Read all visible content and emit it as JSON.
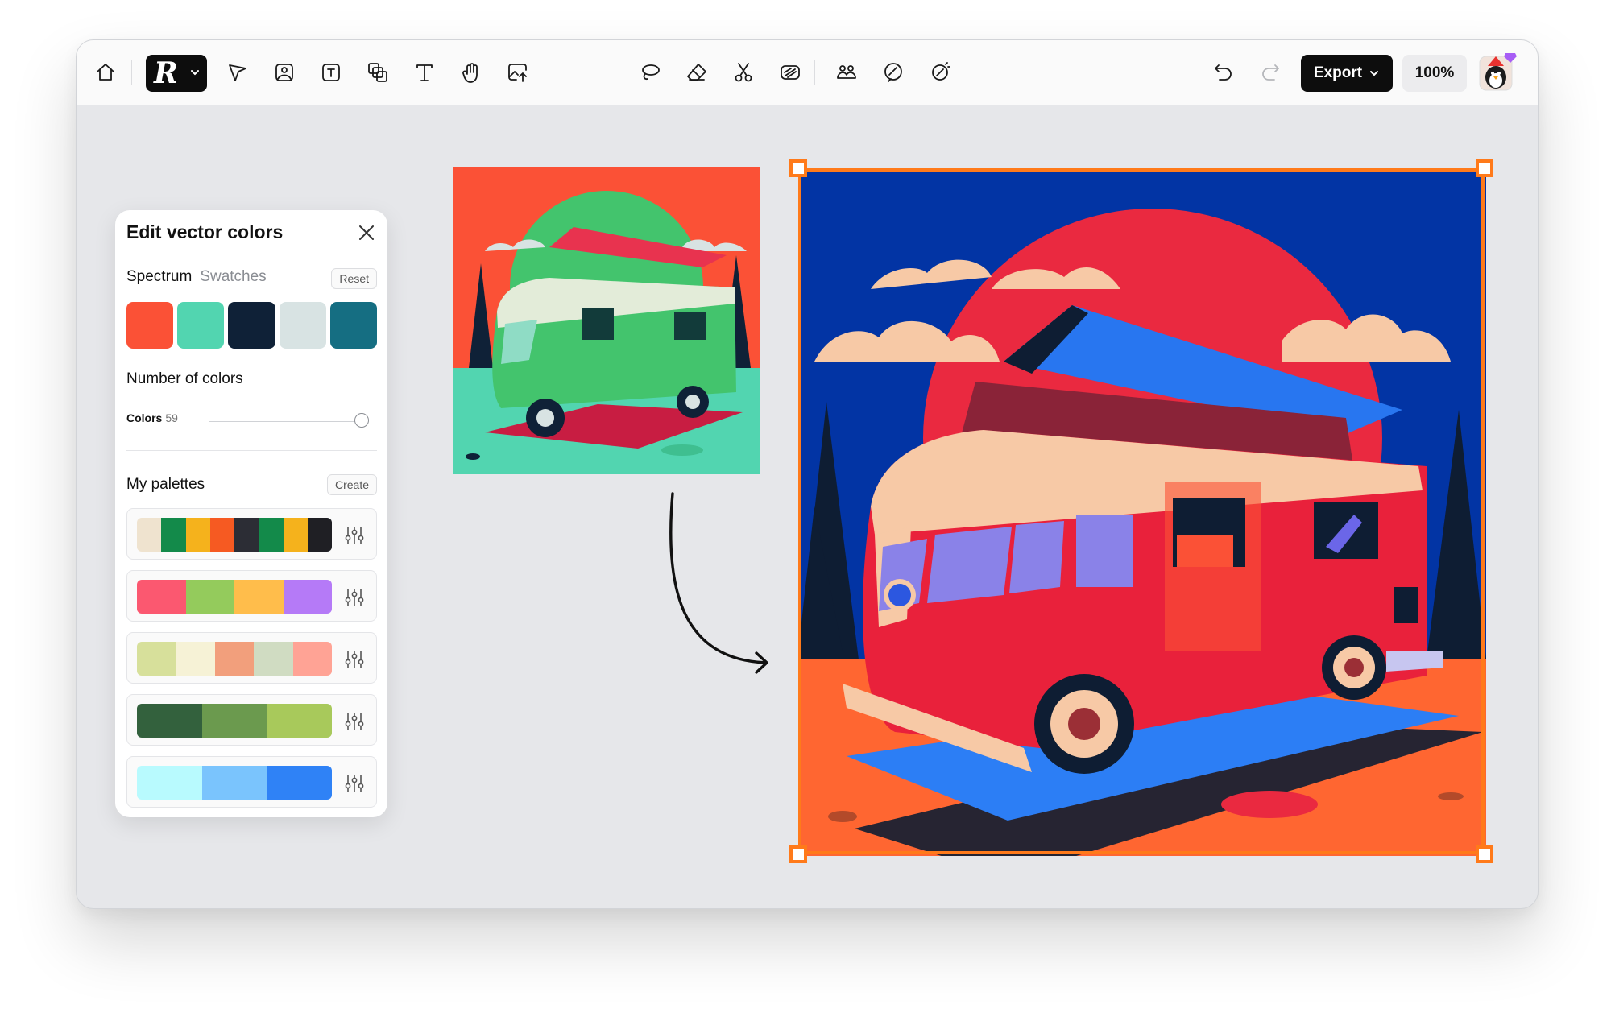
{
  "toolbar": {
    "export_label": "Export",
    "zoom_label": "100%",
    "tools_left": [
      "home-icon",
      "pen-tool-icon",
      "image-icon",
      "image-text-icon",
      "layers-icon",
      "text-icon",
      "hand-icon",
      "upload-image-icon"
    ],
    "tools_center": [
      "lasso-icon",
      "eraser-icon",
      "scissors-icon",
      "vectorize-icon",
      "people-icon",
      "sticker-icon",
      "magic-icon"
    ]
  },
  "panel": {
    "title": "Edit vector colors",
    "tab_spectrum": "Spectrum",
    "tab_swatches": "Swatches",
    "reset_label": "Reset",
    "spectrum_colors": [
      "#fb5136",
      "#52d5b0",
      "#0f2137",
      "#d8e3e3",
      "#156e82"
    ],
    "number_of_colors_label": "Number of colors",
    "colors_label": "Colors",
    "colors_value": "59",
    "colors_slider_fraction": 0.96,
    "my_palettes_label": "My palettes",
    "create_label": "Create",
    "palettes": [
      [
        "#efe3cf",
        "#138a4a",
        "#f5b21c",
        "#f65a22",
        "#2c2d35",
        "#138a4a",
        "#f5b21c",
        "#1f1f24"
      ],
      [
        "#fb5870",
        "#94cb5c",
        "#ffbd4b",
        "#b57af7"
      ],
      [
        "#d7e09b",
        "#f6f2d6",
        "#f29f7c",
        "#d0dcc2",
        "#ffa395"
      ],
      [
        "#33613d",
        "#6b9a4e",
        "#a8c95b"
      ],
      [
        "#b8fafe",
        "#7ac4fd",
        "#2f82f6"
      ]
    ]
  }
}
